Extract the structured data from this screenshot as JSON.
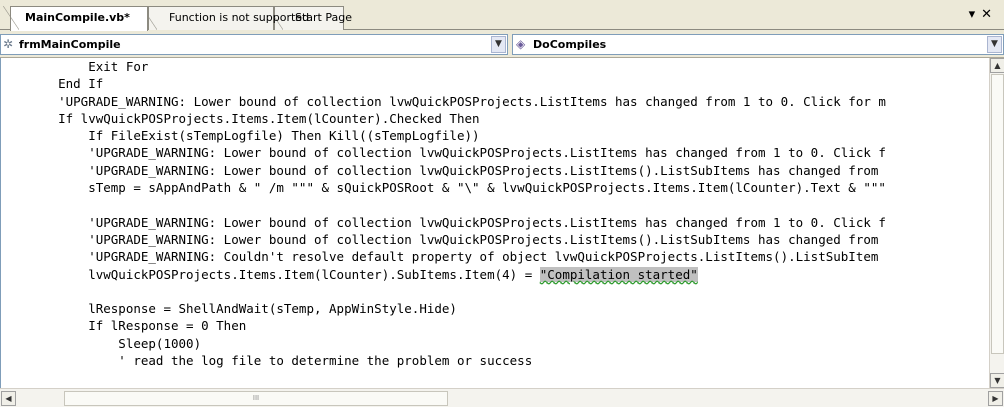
{
  "tabs": [
    {
      "label": "MainCompile.vb*",
      "active": true
    },
    {
      "label": "Function is not supported",
      "active": false
    },
    {
      "label": "Start Page",
      "active": false
    }
  ],
  "tab_controls": {
    "dropdown_icon": "chevron-down-icon",
    "close_icon": "close-icon"
  },
  "object_combo": {
    "value": "frmMainCompile",
    "icon": "form-class-icon"
  },
  "procedure_combo": {
    "value": "DoCompiles",
    "icon": "method-icon"
  },
  "code_lines": [
    "        Exit For",
    "    End If",
    "    'UPGRADE_WARNING: Lower bound of collection lvwQuickPOSProjects.ListItems has changed from 1 to 0. Click for m",
    "    If lvwQuickPOSProjects.Items.Item(lCounter).Checked Then",
    "        If FileExist(sTempLogfile) Then Kill((sTempLogfile))",
    "        'UPGRADE_WARNING: Lower bound of collection lvwQuickPOSProjects.ListItems has changed from 1 to 0. Click f",
    "        'UPGRADE_WARNING: Lower bound of collection lvwQuickPOSProjects.ListItems().ListSubItems has changed from",
    "        sTemp = sAppAndPath & \" /m \"\"\" & sQuickPOSRoot & \"\\\" & lvwQuickPOSProjects.Items.Item(lCounter).Text & \"\"\"",
    "",
    "        'UPGRADE_WARNING: Lower bound of collection lvwQuickPOSProjects.ListItems has changed from 1 to 0. Click f",
    "        'UPGRADE_WARNING: Lower bound of collection lvwQuickPOSProjects.ListItems().ListSubItems has changed from",
    "        'UPGRADE_WARNING: Couldn't resolve default property of object lvwQuickPOSProjects.ListItems().ListSubItem",
    "        lvwQuickPOSProjects.Items.Item(lCounter).SubItems.Item(4) = ",
    "",
    "        lResponse = ShellAndWait(sTemp, AppWinStyle.Hide)",
    "        If lResponse = 0 Then",
    "            Sleep(1000)",
    "            ' read the log file to determine the problem or success"
  ],
  "highlighted_string": "\"Compilation started\"",
  "scrollbars": {
    "h_thumb_grip": "III"
  }
}
